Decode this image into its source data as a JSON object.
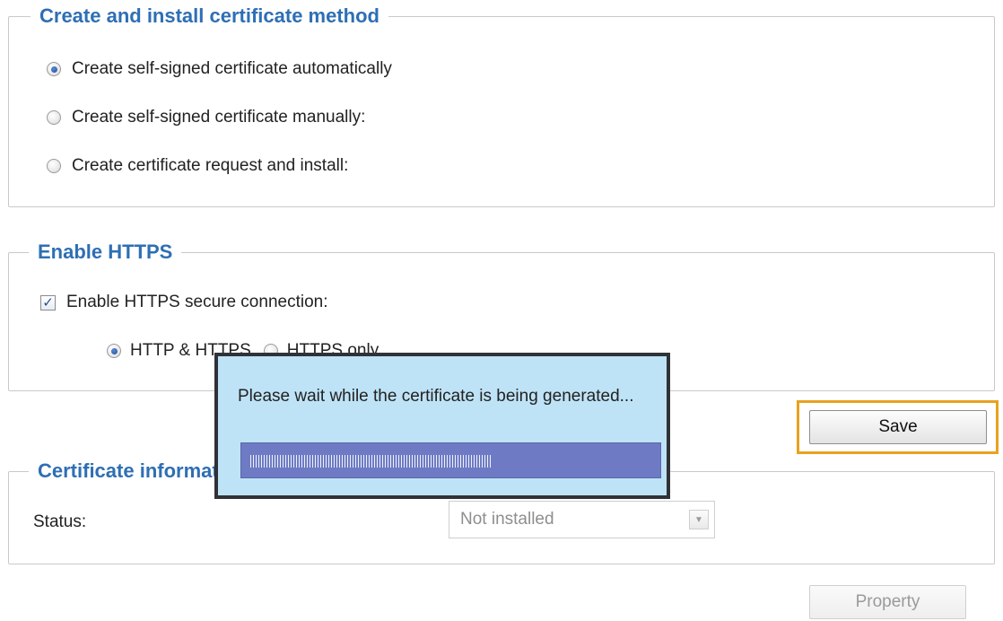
{
  "cert_method": {
    "legend": "Create and install certificate method",
    "options": [
      {
        "label": "Create self-signed certificate automatically",
        "checked": true
      },
      {
        "label": "Create self-signed certificate manually:",
        "checked": false
      },
      {
        "label": "Create certificate request and install:",
        "checked": false
      }
    ]
  },
  "https": {
    "legend": "Enable HTTPS",
    "checkbox_label": "Enable HTTPS secure connection:",
    "checkbox_checked": true,
    "mode_options": [
      {
        "label": "HTTP & HTTPS",
        "checked": true
      },
      {
        "label": "HTTPS only",
        "checked": false
      }
    ]
  },
  "dialog": {
    "message": "Please wait while the certificate is being generated...",
    "progress_fraction": 0.6
  },
  "save_label": "Save",
  "cert_info": {
    "legend": "Certificate information",
    "status_label": "Status:",
    "status_value": "Not installed"
  },
  "property_label": "Property",
  "colors": {
    "legend": "#2e6fb4",
    "highlight": "#e8a21f",
    "dialog_bg": "#bfe3f6",
    "progress_bg": "#6e7bc4"
  }
}
